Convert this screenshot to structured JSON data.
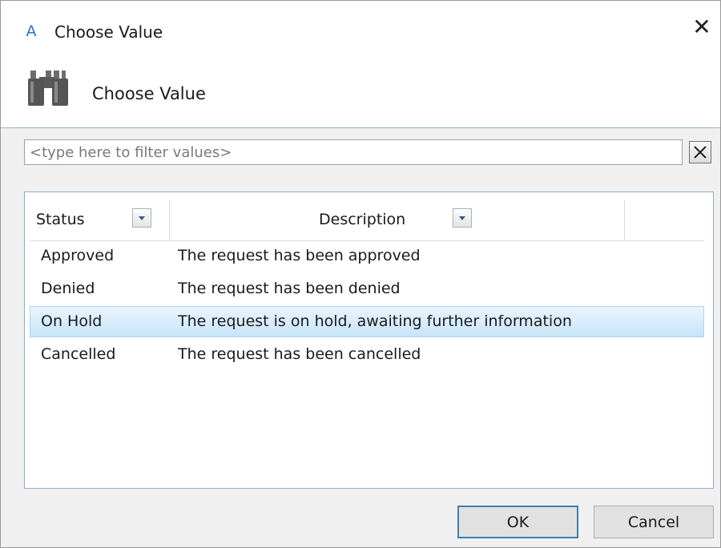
{
  "window": {
    "title": "Choose Value",
    "app_icon_letter": "A",
    "close_glyph": "✕"
  },
  "header": {
    "title": "Choose Value",
    "icon": "binoculars-icon"
  },
  "filter": {
    "value": "",
    "placeholder": "<type here to filter values>",
    "clear_icon": "clear-filter-icon"
  },
  "grid": {
    "columns": [
      {
        "label": "Status"
      },
      {
        "label": "Description"
      }
    ],
    "rows": [
      {
        "status": "Approved",
        "description": "The request has been approved",
        "selected": false
      },
      {
        "status": "Denied",
        "description": "The request has been denied",
        "selected": false
      },
      {
        "status": "On Hold",
        "description": "The request is on hold, awaiting further information",
        "selected": true
      },
      {
        "status": "Cancelled",
        "description": "The request has been cancelled",
        "selected": false
      }
    ]
  },
  "buttons": {
    "ok": "OK",
    "cancel": "Cancel"
  },
  "colors": {
    "accent": "#2a72c8",
    "selection": "#c7e4f8",
    "default_button_border": "#3c7fb1"
  }
}
